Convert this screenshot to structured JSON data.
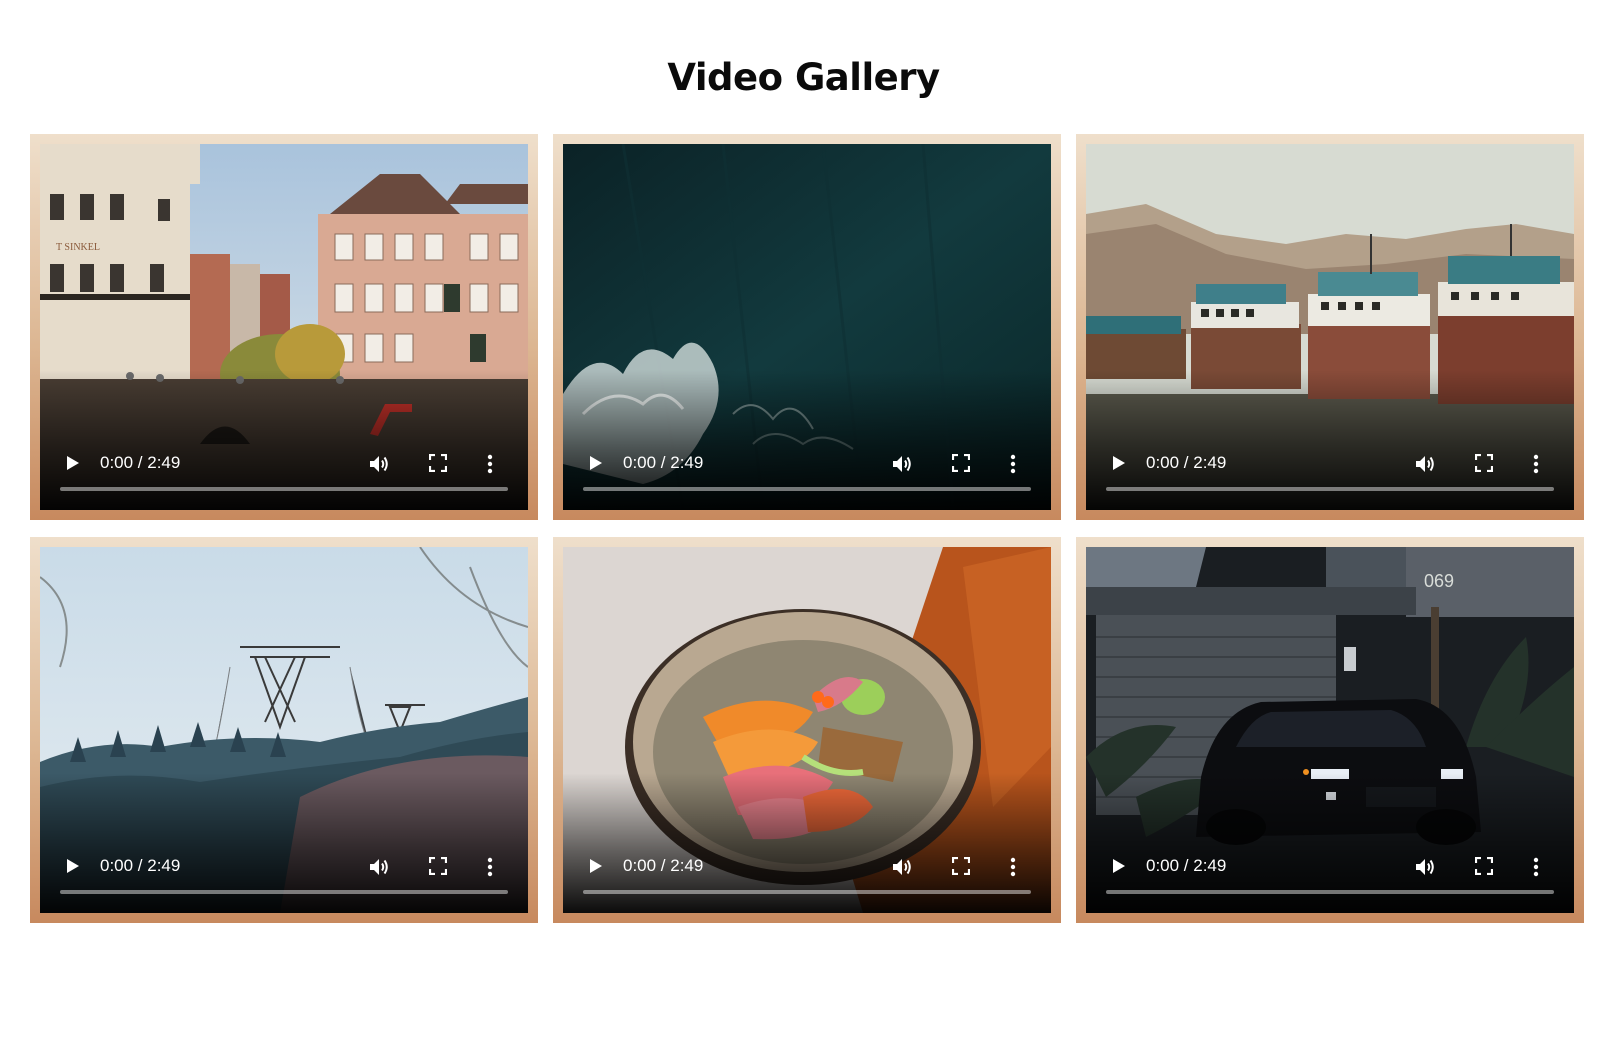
{
  "page": {
    "title": "Video Gallery"
  },
  "videos": [
    {
      "scene": "canal-street-buildings",
      "time_label": "0:00 / 2:49",
      "progress": 0,
      "sign_text": "T SINKEL"
    },
    {
      "scene": "aerial-dark-ocean-waves",
      "time_label": "0:00 / 2:49",
      "progress": 0
    },
    {
      "scene": "old-ships-on-shore",
      "time_label": "0:00 / 2:49",
      "progress": 0
    },
    {
      "scene": "forest-hill-power-pylons",
      "time_label": "0:00 / 2:49",
      "progress": 0
    },
    {
      "scene": "sashimi-bowl-on-table",
      "time_label": "0:00 / 2:49",
      "progress": 0
    },
    {
      "scene": "black-car-by-garage-night",
      "time_label": "0:00 / 2:49",
      "progress": 0,
      "house_number": "069"
    }
  ],
  "icons": {
    "play": "play-icon",
    "volume": "volume-icon",
    "fullscreen": "fullscreen-icon",
    "more": "more-vertical-icon"
  },
  "colors": {
    "frame_top": "#efdfcb",
    "frame_bottom": "#c7895e",
    "title": "#0a0a0a",
    "controls": "#ffffff"
  }
}
